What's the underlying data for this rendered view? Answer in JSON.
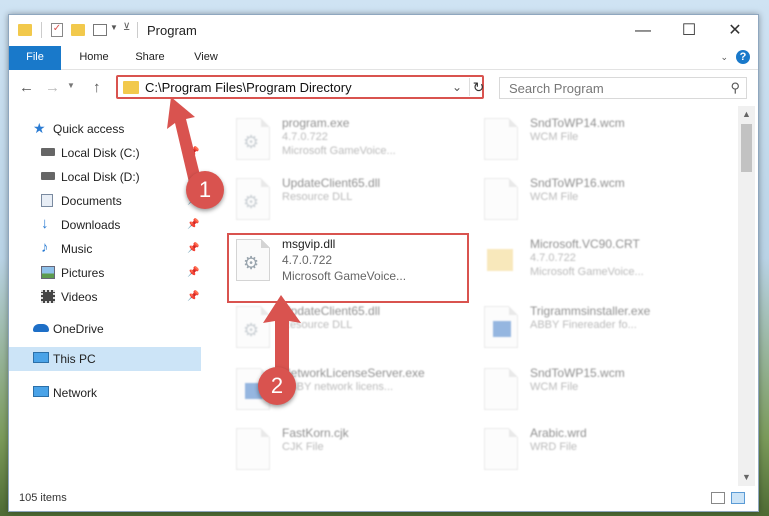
{
  "window": {
    "title": "Program",
    "minimize": "—",
    "maximize": "☐",
    "close": "✕"
  },
  "ribbon": {
    "tabs": [
      "File",
      "Home",
      "Share",
      "View"
    ],
    "help": "?"
  },
  "nav": {
    "address": "C:\\Program Files\\Program Directory",
    "search_placeholder": "Search Program"
  },
  "sidebar": {
    "items": [
      {
        "label": "Quick access",
        "icon": "star-icon",
        "pinned": false,
        "selected": false
      },
      {
        "label": "Local Disk (C:)",
        "icon": "drive-icon",
        "pinned": true,
        "selected": false
      },
      {
        "label": "Local Disk (D:)",
        "icon": "drive-icon",
        "pinned": true,
        "selected": false
      },
      {
        "label": "Documents",
        "icon": "documents-icon",
        "pinned": true,
        "selected": false
      },
      {
        "label": "Downloads",
        "icon": "download-icon",
        "pinned": true,
        "selected": false
      },
      {
        "label": "Music",
        "icon": "music-icon",
        "pinned": true,
        "selected": false
      },
      {
        "label": "Pictures",
        "icon": "pictures-icon",
        "pinned": true,
        "selected": false
      },
      {
        "label": "Videos",
        "icon": "videos-icon",
        "pinned": true,
        "selected": false
      },
      {
        "label": "OneDrive",
        "icon": "cloud-icon",
        "pinned": false,
        "selected": false
      },
      {
        "label": "This PC",
        "icon": "computer-icon",
        "pinned": false,
        "selected": true
      },
      {
        "label": "Network",
        "icon": "network-icon",
        "pinned": false,
        "selected": false
      }
    ]
  },
  "files": [
    {
      "name": "program.exe",
      "line1": "4.7.0.722",
      "line2": "Microsoft GameVoice...",
      "icon": "exe-icon",
      "dim": true
    },
    {
      "name": "SndToWP14.wcm",
      "line1": "WCM File",
      "line2": "",
      "icon": "file-icon",
      "dim": true
    },
    {
      "name": "UpdateClient65.dll",
      "line1": "Resource DLL",
      "line2": "",
      "icon": "dll-icon",
      "dim": true
    },
    {
      "name": "SndToWP16.wcm",
      "line1": "WCM File",
      "line2": "",
      "icon": "file-icon",
      "dim": true
    },
    {
      "name": "msgvip.dll",
      "line1": "4.7.0.722",
      "line2": "Microsoft GameVoice...",
      "icon": "dll-icon",
      "dim": false
    },
    {
      "name": "Microsoft.VC90.CRT",
      "line1": "4.7.0.722",
      "line2": "Microsoft GameVoice...",
      "icon": "folder-icon",
      "dim": true
    },
    {
      "name": "UpdateClient65.dll",
      "line1": "Resource DLL",
      "line2": "",
      "icon": "dll-icon",
      "dim": true
    },
    {
      "name": "Trigrammsinstaller.exe",
      "line1": "ABBY Finereader fo...",
      "line2": "",
      "icon": "installer-icon",
      "dim": true
    },
    {
      "name": "NetworkLicenseServer.exe",
      "line1": "ABBY network licens...",
      "line2": "",
      "icon": "installer-icon",
      "dim": true
    },
    {
      "name": "SndToWP15.wcm",
      "line1": "WCM File",
      "line2": "",
      "icon": "file-icon",
      "dim": true
    },
    {
      "name": "FastKorn.cjk",
      "line1": "CJK File",
      "line2": "",
      "icon": "file-icon",
      "dim": true
    },
    {
      "name": "Arabic.wrd",
      "line1": "WRD File",
      "line2": "",
      "icon": "file-icon",
      "dim": true
    }
  ],
  "status": {
    "count": "105 items"
  },
  "annotations": {
    "step1": "1",
    "step2": "2",
    "accent": "#d9534f"
  }
}
